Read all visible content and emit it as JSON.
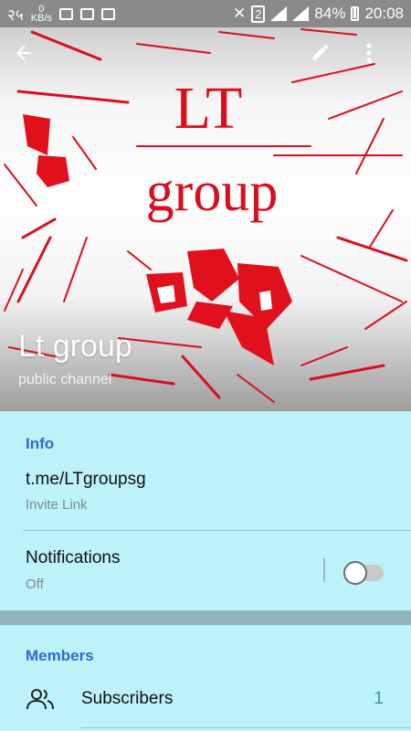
{
  "status_bar": {
    "left_text": "२५",
    "speed_value": "0",
    "speed_unit": "KB/s",
    "sim_label": "2",
    "battery": "84%",
    "time": "20:08"
  },
  "header": {
    "logo_line1": "LT",
    "logo_line2": "group",
    "title": "Lt group",
    "subtitle": "public channel",
    "icons": [
      "arrow-left",
      "pencil",
      "more-vertical"
    ],
    "colors": {
      "logo_red": "#d90f1e",
      "text_white": "#ffffff"
    }
  },
  "info": {
    "header": "Info",
    "link": "t.me/LTgroupsg",
    "link_caption": "Invite Link",
    "notifications_label": "Notifications",
    "notifications_value": "Off",
    "notifications_enabled": false
  },
  "members": {
    "header": "Members",
    "subscribers_label": "Subscribers",
    "subscribers_count": "1"
  },
  "colors": {
    "background": "#bdf2f8",
    "accent": "#2f6bd1",
    "count": "#3f8fa9"
  }
}
